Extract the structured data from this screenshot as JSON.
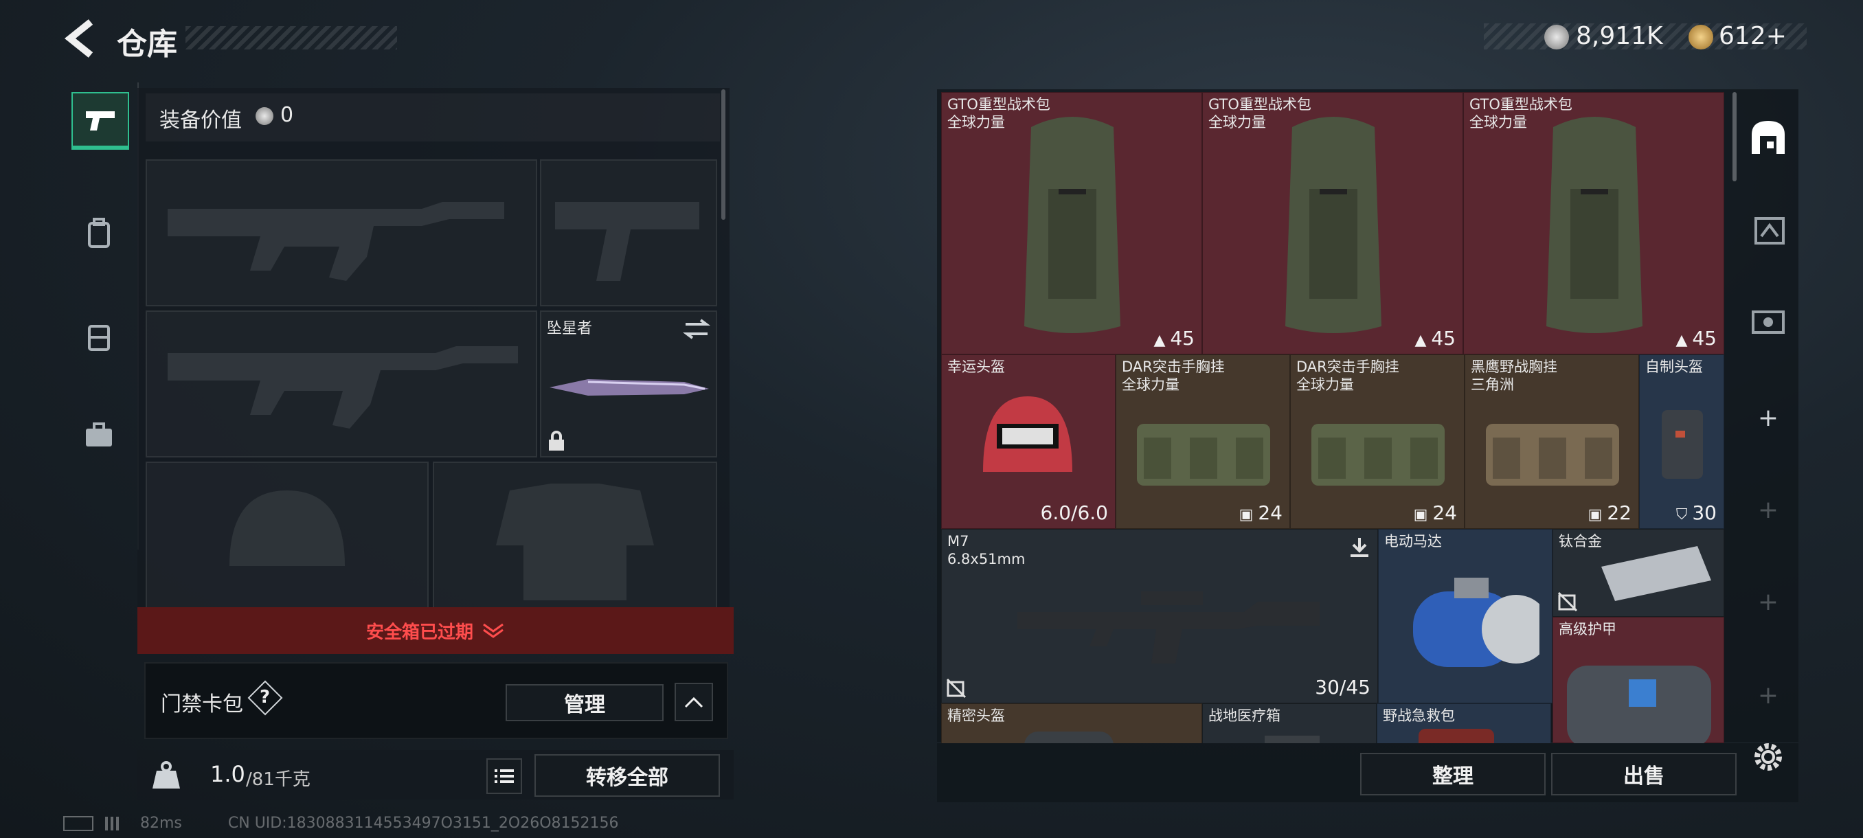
{
  "header": {
    "title": "仓库"
  },
  "currency": [
    {
      "icon": "silver-coin-icon",
      "value": "8,911K"
    },
    {
      "icon": "gold-coin-icon",
      "value": "612+"
    }
  ],
  "loadout": {
    "equip_value_label": "装备价值",
    "equip_value": "0",
    "melee_name": "坠星者",
    "safe_box_status": "安全箱已过期",
    "keycard": {
      "label": "门禁卡包",
      "help": "?",
      "manage": "管理"
    },
    "weight": {
      "current": "1.0",
      "max": "/81千克"
    },
    "transfer_all": "转移全部"
  },
  "storage": {
    "items": [
      {
        "name": "GTO重型战术包\n全球力量",
        "value": "45",
        "value_icon": "capacity-icon"
      },
      {
        "name": "GTO重型战术包\n全球力量",
        "value": "45",
        "value_icon": "capacity-icon"
      },
      {
        "name": "GTO重型战术包\n全球力量",
        "value": "45",
        "value_icon": "capacity-icon"
      },
      {
        "name": "幸运头盔",
        "value": "6.0/6.0",
        "value_icon": ""
      },
      {
        "name": "DAR突击手胸挂\n全球力量",
        "value": "24",
        "value_icon": "vest-icon"
      },
      {
        "name": "DAR突击手胸挂\n全球力量",
        "value": "24",
        "value_icon": "vest-icon"
      },
      {
        "name": "黑鹰野战胸挂\n三角洲",
        "value": "22",
        "value_icon": "vest-icon"
      },
      {
        "name": "自制头盔",
        "value": "30",
        "value_icon": "shield-icon"
      },
      {
        "name": "M7\n6.8x51mm",
        "value": "30/45",
        "value_icon": ""
      },
      {
        "name": "电动马达",
        "value": "",
        "value_icon": ""
      },
      {
        "name": "钛合金",
        "value": "",
        "value_icon": ""
      },
      {
        "name": "高级护甲",
        "value": "",
        "value_icon": ""
      },
      {
        "name": "精密头盔",
        "value": "",
        "value_icon": ""
      },
      {
        "name": "战地医疗箱",
        "value": "",
        "value_icon": ""
      },
      {
        "name": "野战急救包",
        "value": "",
        "value_icon": ""
      }
    ],
    "sort": "整理",
    "sell": "出售"
  },
  "status_bar": {
    "ping": "82ms",
    "uid": "CN UID:1830883114553497O3151_2O26O8152156"
  },
  "colors": {
    "accent_green": "#2fbf8f",
    "alert_red": "#ff4d4d",
    "rare_red": "#5a2730",
    "rare_brown": "#45382c",
    "rare_blue": "#27364a"
  }
}
